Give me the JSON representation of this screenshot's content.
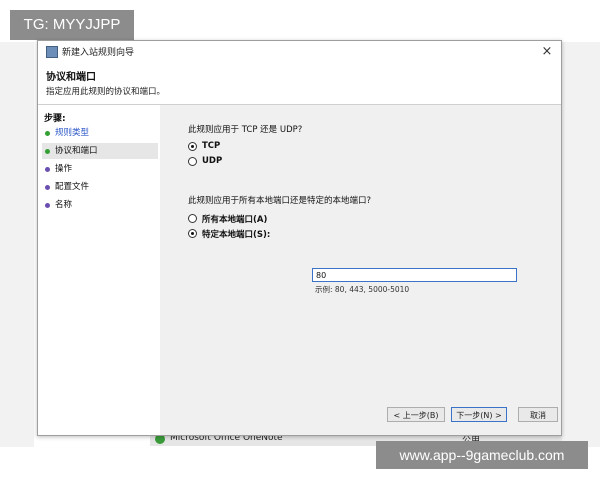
{
  "watermarks": {
    "top": "TG: MYYJJPP",
    "bottom": "www.app--9gameclub.com"
  },
  "window": {
    "title": "新建入站规则向导",
    "close_label": "×"
  },
  "header": {
    "title": "协议和端口",
    "subtitle": "指定应用此规则的协议和端口。"
  },
  "sidebar": {
    "steps_title": "步骤:",
    "items": [
      {
        "label": "规则类型",
        "state": "done"
      },
      {
        "label": "协议和端口",
        "state": "active"
      },
      {
        "label": "操作",
        "state": "pending"
      },
      {
        "label": "配置文件",
        "state": "pending"
      },
      {
        "label": "名称",
        "state": "pending"
      }
    ]
  },
  "protocol": {
    "question": "此规则应用于 TCP 还是 UDP?",
    "options": [
      {
        "label": "TCP",
        "selected": true
      },
      {
        "label": "UDP",
        "selected": false
      }
    ]
  },
  "ports": {
    "question": "此规则应用于所有本地端口还是特定的本地端口?",
    "options": [
      {
        "label": "所有本地端口(A)",
        "selected": false
      },
      {
        "label": "特定本地端口(S):",
        "selected": true
      }
    ],
    "value": "80",
    "example": "示例: 80, 443, 5000-5010"
  },
  "buttons": {
    "back": "< 上一步(B)",
    "next": "下一步(N) >",
    "cancel": "取消"
  },
  "taskbar": {
    "item_text": "Microsoft Office OneNote",
    "right_text": "公用"
  },
  "colors": {
    "accent": "#3b73c9",
    "step_done": "#33a033",
    "step_pending": "#6a4fb0",
    "link": "#2b57c7"
  }
}
